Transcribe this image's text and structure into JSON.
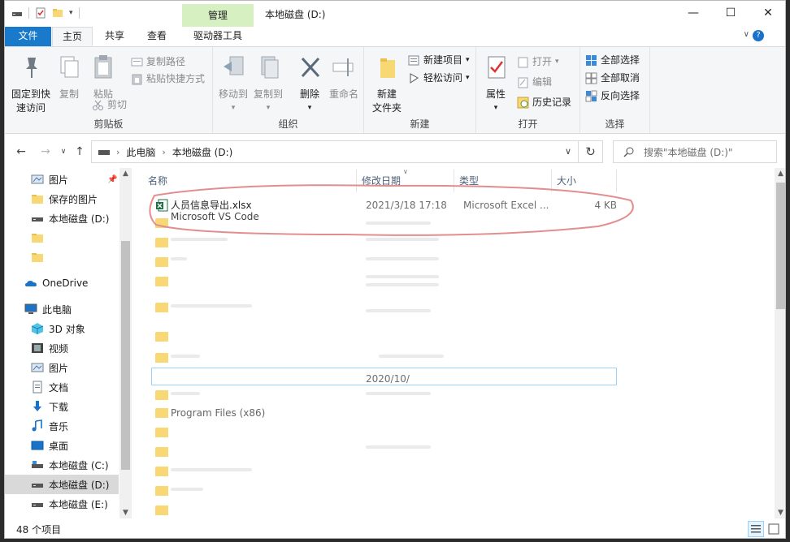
{
  "title_bar": {
    "title": "本地磁盘 (D:)",
    "manage_tab": "管理",
    "minimize": "—",
    "maximize": "☐",
    "close": "✕"
  },
  "ribbon_tabs": [
    "文件",
    "主页",
    "共享",
    "查看",
    "驱动器工具"
  ],
  "ribbon": {
    "clipboard": {
      "pin_line1": "固定到快",
      "pin_line2": "速访问",
      "copy": "复制",
      "paste": "粘贴",
      "copy_path": "复制路径",
      "paste_shortcut": "粘贴快捷方式",
      "cut": "剪切",
      "label": "剪贴板"
    },
    "organize": {
      "move_to": "移动到",
      "copy_to": "复制到",
      "delete": "删除",
      "rename": "重命名",
      "label": "组织"
    },
    "new": {
      "new_folder_line1": "新建",
      "new_folder_line2": "文件夹",
      "new_item": "新建项目",
      "easy_access": "轻松访问",
      "label": "新建"
    },
    "open": {
      "properties": "属性",
      "open": "打开",
      "edit": "编辑",
      "history": "历史记录",
      "label": "打开"
    },
    "select": {
      "select_all": "全部选择",
      "select_none": "全部取消",
      "invert": "反向选择",
      "label": "选择"
    }
  },
  "address": {
    "crumbs": [
      "此电脑",
      "本地磁盘 (D:)"
    ],
    "search_placeholder": "搜索\"本地磁盘 (D:)\""
  },
  "nav_pane": {
    "items": [
      {
        "label": "图片",
        "icon": "pictures-icon",
        "pinned": true
      },
      {
        "label": "保存的图片",
        "icon": "folder-icon"
      },
      {
        "label": "本地磁盘 (D:)",
        "icon": "drive-icon"
      },
      {
        "label": "",
        "icon": "folder-icon"
      },
      {
        "label": "",
        "icon": "folder-icon"
      },
      {
        "label": "OneDrive",
        "icon": "onedrive-icon"
      },
      {
        "label": "此电脑",
        "icon": "pc-icon"
      },
      {
        "label": "3D 对象",
        "icon": "3d-objects-icon"
      },
      {
        "label": "视频",
        "icon": "video-icon"
      },
      {
        "label": "图片",
        "icon": "pictures-icon"
      },
      {
        "label": "文档",
        "icon": "documents-icon"
      },
      {
        "label": "下载",
        "icon": "download-icon"
      },
      {
        "label": "音乐",
        "icon": "music-icon"
      },
      {
        "label": "桌面",
        "icon": "desktop-icon"
      },
      {
        "label": "本地磁盘 (C:)",
        "icon": "system-drive-icon"
      },
      {
        "label": "本地磁盘 (D:)",
        "icon": "drive-icon",
        "selected": true
      },
      {
        "label": "本地磁盘 (E:)",
        "icon": "drive-icon"
      }
    ]
  },
  "file_list": {
    "columns": [
      "名称",
      "修改日期",
      "类型",
      "大小"
    ],
    "highlighted_file": {
      "name": "人员信息导出.xlsx",
      "modified": "2021/3/18 17:18",
      "type": "Microsoft Excel ...",
      "size": "4 KB"
    },
    "obscured_rows": [
      {
        "name": "Microsoft VS Code",
        "modified": "",
        "type": ""
      },
      {
        "name": "",
        "modified": "",
        "type": ""
      },
      {
        "name": "",
        "modified": "",
        "type": ""
      },
      {
        "name": "",
        "modified": "",
        "type": ""
      },
      {
        "name": "",
        "modified": "",
        "type": ""
      },
      {
        "name": "",
        "modified": "",
        "type": ""
      },
      {
        "name": "",
        "modified": "",
        "type": ""
      },
      {
        "name": "",
        "modified": "",
        "type": ""
      },
      {
        "name": "",
        "modified": "2020/10/",
        "type": ""
      },
      {
        "name": "",
        "modified": "",
        "type": ""
      },
      {
        "name": "Program Files (x86)",
        "modified": "",
        "type": ""
      },
      {
        "name": "",
        "modified": "",
        "type": ""
      },
      {
        "name": "",
        "modified": "",
        "type": ""
      },
      {
        "name": "",
        "modified": "",
        "type": ""
      },
      {
        "name": "",
        "modified": "",
        "type": ""
      },
      {
        "name": "",
        "modified": "",
        "type": ""
      },
      {
        "name": "",
        "modified": "",
        "type": ""
      }
    ],
    "annotation_color": "#e38e8e"
  },
  "status_bar": {
    "item_count": "48 个项目"
  },
  "colors": {
    "file_tab": "#1979ca",
    "manage_tab": "#d6f0c2",
    "folder": "#f8d775",
    "excel": "#1d7044"
  }
}
